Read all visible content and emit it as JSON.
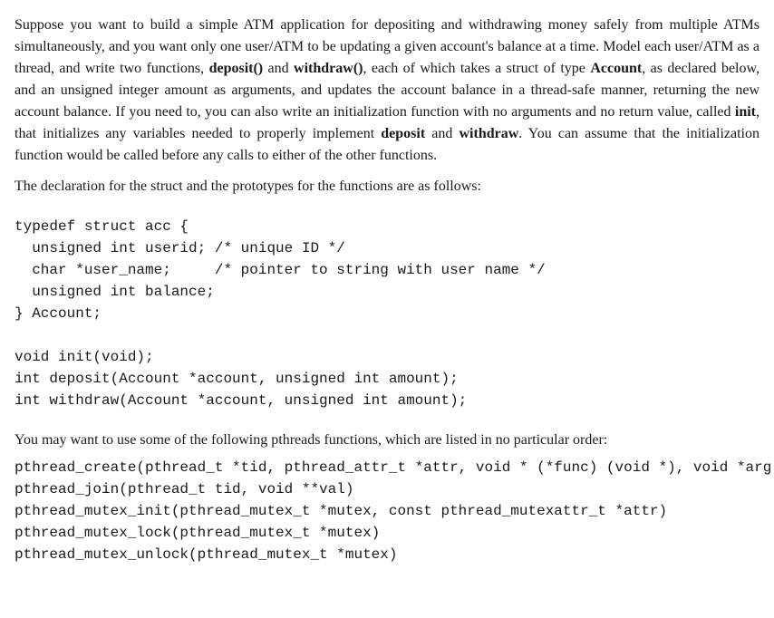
{
  "paragraphs": {
    "p1_part1": "Suppose you want to build a simple ATM application for depositing and withdrawing money safely from multiple ATMs simultaneously, and you want only one user/ATM to be updating a given account's balance at a time. Model each user/ATM as a thread, and write two functions, ",
    "p1_bold1": "deposit()",
    "p1_part2": " and ",
    "p1_bold2": "withdraw()",
    "p1_part3": ", each of which takes a struct of type ",
    "p1_bold3": "Account",
    "p1_part4": ", as declared below, and an unsigned integer amount as arguments, and updates the account balance in a thread-safe manner, returning the new account balance. If you need to, you can also write an initialization function with no arguments and no return value, called ",
    "p1_bold4": "init",
    "p1_part5": ", that initializes any variables needed to properly implement ",
    "p1_bold5": "deposit",
    "p1_part6": " and ",
    "p1_bold6": "withdraw",
    "p1_part7": ". You can assume that the initialization function would be called before any calls to either of the other functions.",
    "p2": "The declaration for the struct and the prototypes for the functions are as follows:",
    "p3": "You may want to use some of the following pthreads functions, which are listed in no particular order:"
  },
  "code": {
    "struct_block": "typedef struct acc {\n  unsigned int userid; /* unique ID */\n  char *user_name;     /* pointer to string with user name */\n  unsigned int balance;\n} Account;\n\nvoid init(void);\nint deposit(Account *account, unsigned int amount);\nint withdraw(Account *account, unsigned int amount);",
    "pthreads_block": "pthread_create(pthread_t *tid, pthread_attr_t *attr, void * (*func) (void *), void *arg)\npthread_join(pthread_t tid, void **val)\npthread_mutex_init(pthread_mutex_t *mutex, const pthread_mutexattr_t *attr)\npthread_mutex_lock(pthread_mutex_t *mutex)\npthread_mutex_unlock(pthread_mutex_t *mutex)"
  }
}
